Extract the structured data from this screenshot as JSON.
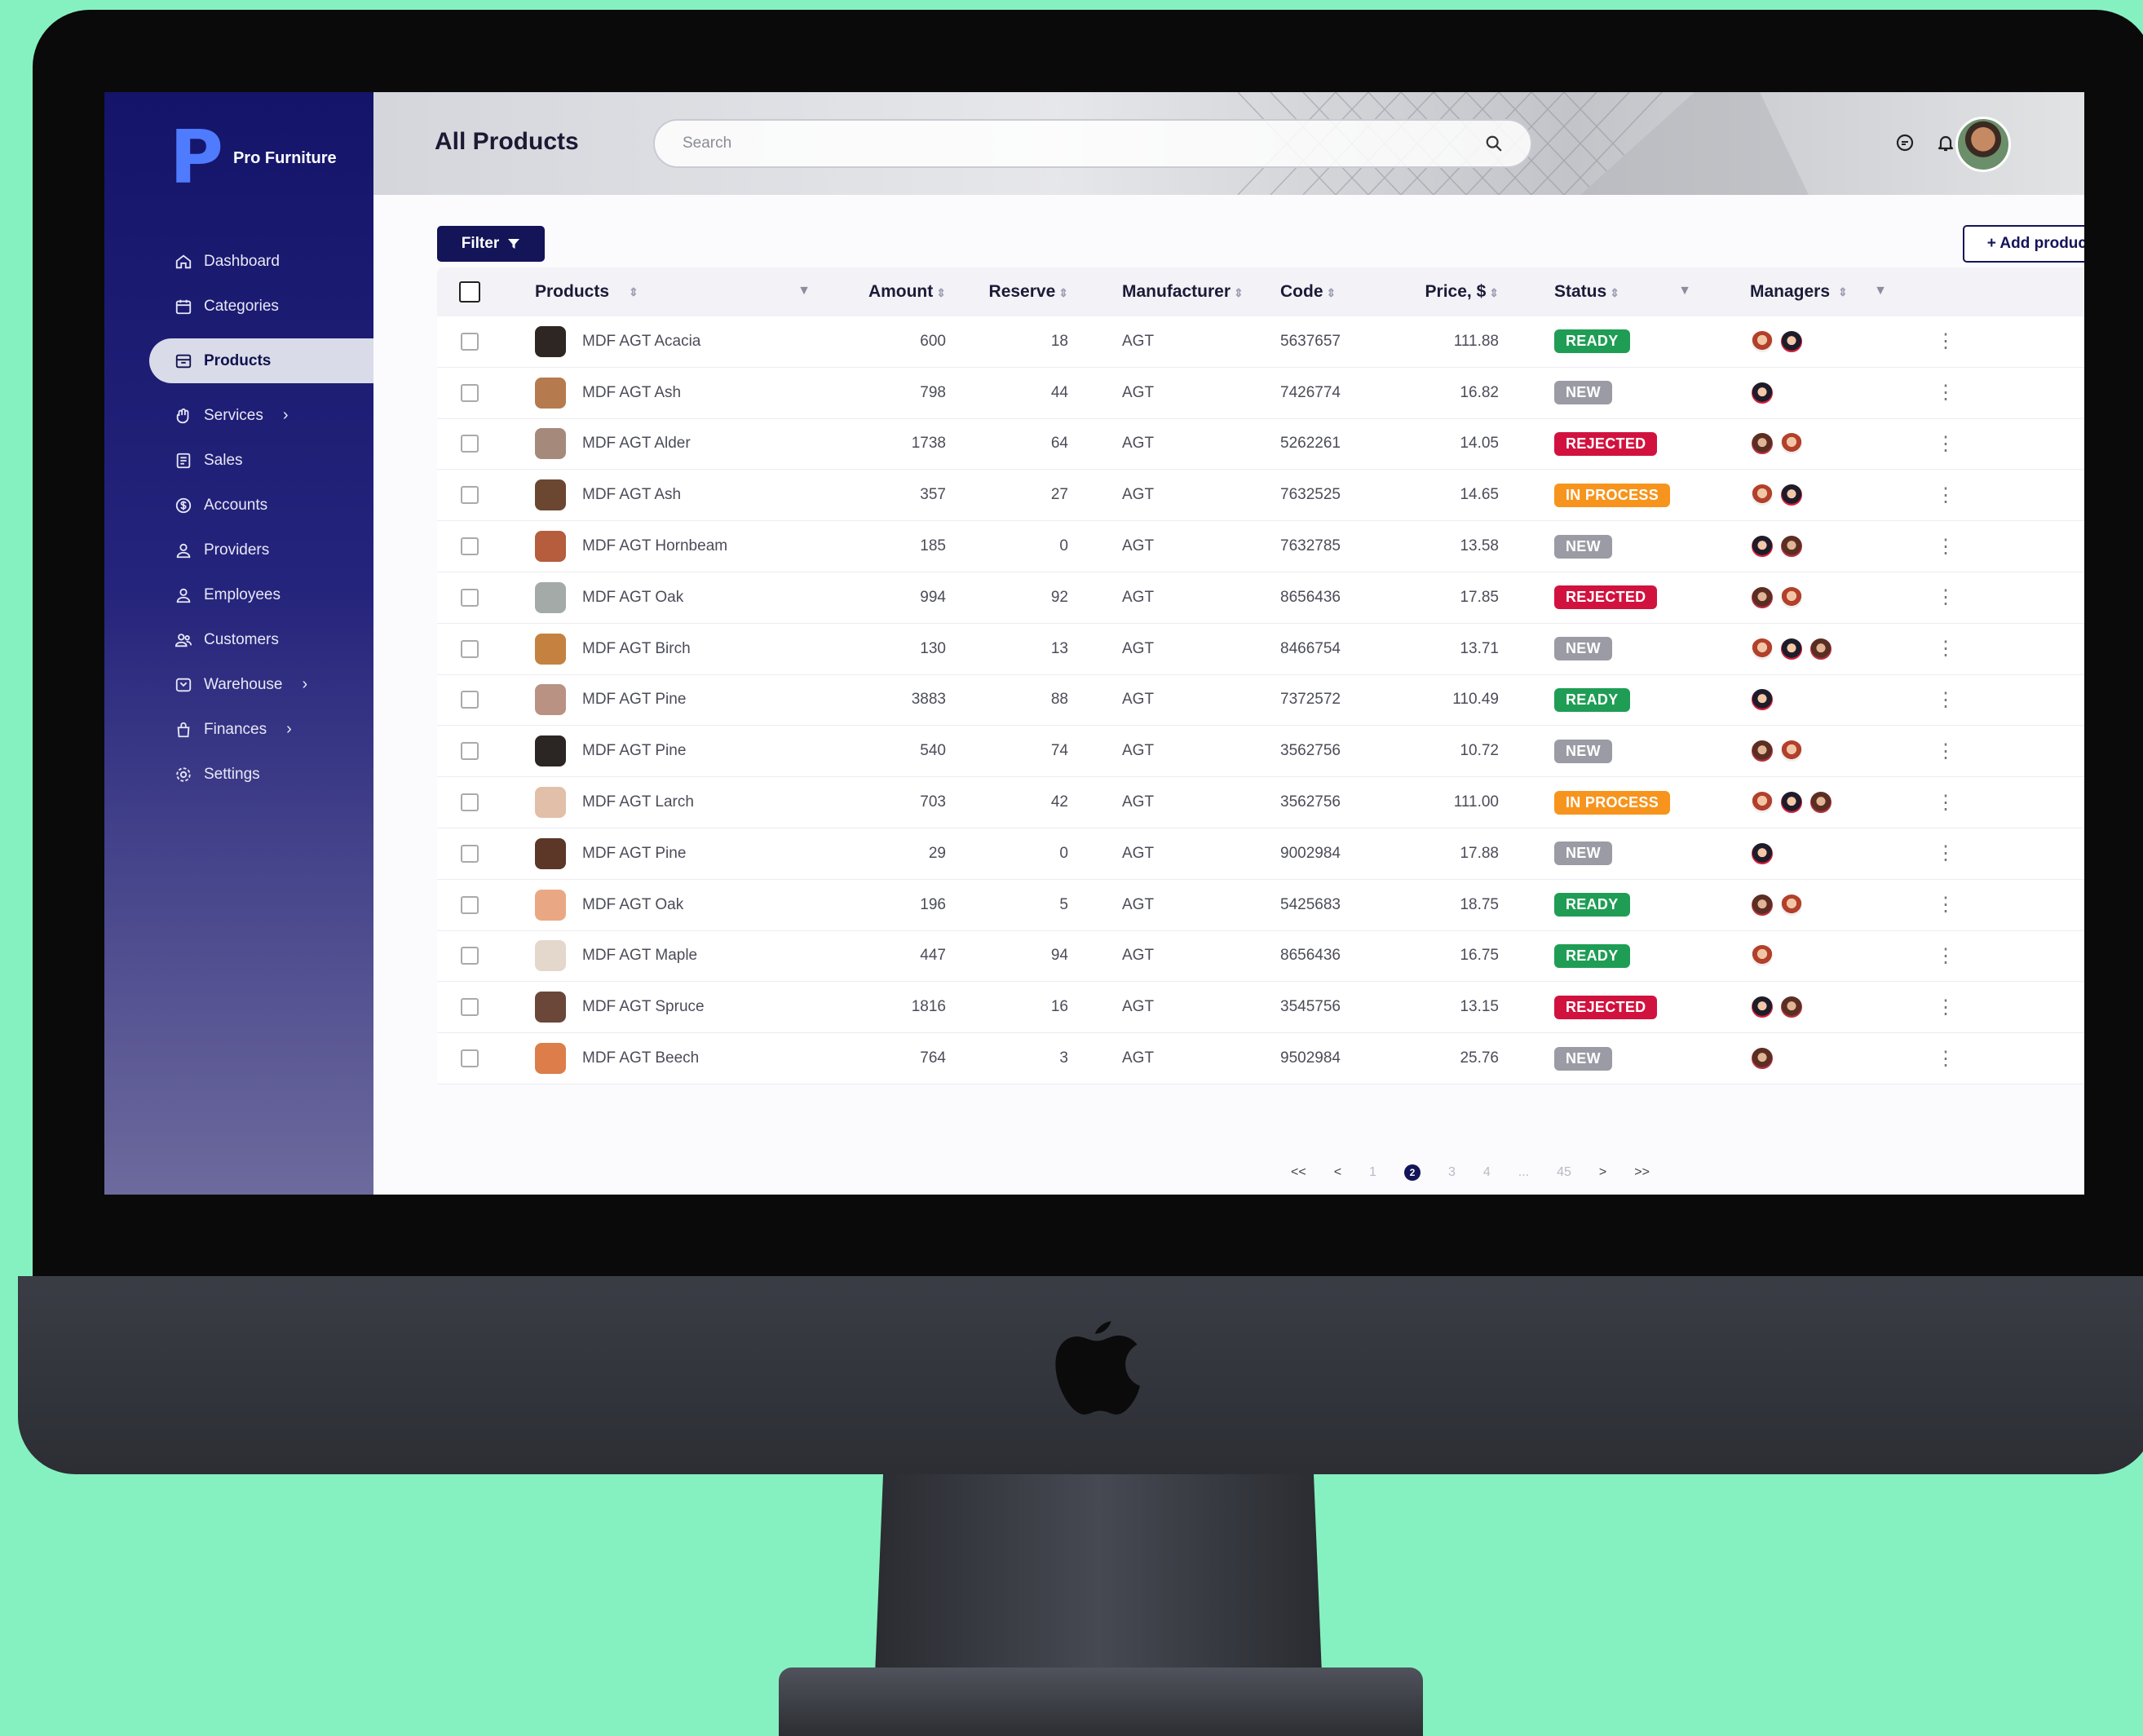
{
  "app": {
    "brand_letter": "P",
    "brand_name": "Pro Furniture",
    "page_title": "All Products"
  },
  "search": {
    "placeholder": "Search"
  },
  "sidebar": {
    "items": [
      {
        "label": "Dashboard",
        "icon": "home-icon",
        "chevron": false,
        "active": false
      },
      {
        "label": "Categories",
        "icon": "calendar-icon",
        "chevron": false,
        "active": false
      },
      {
        "label": "Products",
        "icon": "box-icon",
        "chevron": false,
        "active": true
      },
      {
        "label": "Services",
        "icon": "hand-icon",
        "chevron": true,
        "active": false
      },
      {
        "label": "Sales",
        "icon": "receipt-icon",
        "chevron": false,
        "active": false
      },
      {
        "label": "Accounts",
        "icon": "dollar-icon",
        "chevron": false,
        "active": false
      },
      {
        "label": "Providers",
        "icon": "user-icon",
        "chevron": false,
        "active": false
      },
      {
        "label": "Employees",
        "icon": "user-icon",
        "chevron": false,
        "active": false
      },
      {
        "label": "Customers",
        "icon": "users-icon",
        "chevron": false,
        "active": false
      },
      {
        "label": "Warehouse",
        "icon": "warehouse-icon",
        "chevron": true,
        "active": false
      },
      {
        "label": "Finances",
        "icon": "bag-icon",
        "chevron": true,
        "active": false
      },
      {
        "label": "Settings",
        "icon": "gear-icon",
        "chevron": false,
        "active": false
      }
    ]
  },
  "toolbar": {
    "filter_label": "Filter",
    "add_label": "+ Add product"
  },
  "table": {
    "headers": {
      "products": "Products",
      "amount": "Amount",
      "reserve": "Reserve",
      "manufacturer": "Manufacturer",
      "code": "Code",
      "price": "Price, $",
      "status": "Status",
      "managers": "Managers"
    },
    "status_colors": {
      "READY": "#1f9d55",
      "NEW": "#9a9ba4",
      "REJECTED": "#d1123f",
      "IN PROCESS": "#f7941d"
    },
    "rows": [
      {
        "product": "MDF AGT Acacia",
        "amount": "600",
        "reserve": "18",
        "manufacturer": "AGT",
        "code": "5637657",
        "price": "111.88",
        "status": "READY",
        "swatch": "#2e2622",
        "managers": 2
      },
      {
        "product": "MDF AGT Ash",
        "amount": "798",
        "reserve": "44",
        "manufacturer": "AGT",
        "code": "7426774",
        "price": "16.82",
        "status": "NEW",
        "swatch": "#b57a4e",
        "managers": 1
      },
      {
        "product": "MDF AGT Alder",
        "amount": "1738",
        "reserve": "64",
        "manufacturer": "AGT",
        "code": "5262261",
        "price": "14.05",
        "status": "REJECTED",
        "swatch": "#a58a7c",
        "managers": 2
      },
      {
        "product": "MDF AGT Ash",
        "amount": "357",
        "reserve": "27",
        "manufacturer": "AGT",
        "code": "7632525",
        "price": "14.65",
        "status": "IN PROCESS",
        "swatch": "#6b4630",
        "managers": 2
      },
      {
        "product": "MDF AGT Hornbeam",
        "amount": "185",
        "reserve": "0",
        "manufacturer": "AGT",
        "code": "7632785",
        "price": "13.58",
        "status": "NEW",
        "swatch": "#b55d3c",
        "managers": 2
      },
      {
        "product": "MDF AGT Oak",
        "amount": "994",
        "reserve": "92",
        "manufacturer": "AGT",
        "code": "8656436",
        "price": "17.85",
        "status": "REJECTED",
        "swatch": "#a3aaa8",
        "managers": 2
      },
      {
        "product": "MDF AGT Birch",
        "amount": "130",
        "reserve": "13",
        "manufacturer": "AGT",
        "code": "8466754",
        "price": "13.71",
        "status": "NEW",
        "swatch": "#c5813f",
        "managers": 3
      },
      {
        "product": "MDF AGT Pine",
        "amount": "3883",
        "reserve": "88",
        "manufacturer": "AGT",
        "code": "7372572",
        "price": "110.49",
        "status": "READY",
        "swatch": "#b99283",
        "managers": 1
      },
      {
        "product": "MDF AGT Pine",
        "amount": "540",
        "reserve": "74",
        "manufacturer": "AGT",
        "code": "3562756",
        "price": "10.72",
        "status": "NEW",
        "swatch": "#2b2624",
        "managers": 2
      },
      {
        "product": "MDF AGT Larch",
        "amount": "703",
        "reserve": "42",
        "manufacturer": "AGT",
        "code": "3562756",
        "price": "111.00",
        "status": "IN PROCESS",
        "swatch": "#e2bfa8",
        "managers": 3
      },
      {
        "product": "MDF AGT Pine",
        "amount": "29",
        "reserve": "0",
        "manufacturer": "AGT",
        "code": "9002984",
        "price": "17.88",
        "status": "NEW",
        "swatch": "#5c3626",
        "managers": 1
      },
      {
        "product": "MDF AGT Oak",
        "amount": "196",
        "reserve": "5",
        "manufacturer": "AGT",
        "code": "5425683",
        "price": "18.75",
        "status": "READY",
        "swatch": "#e9a883",
        "managers": 2
      },
      {
        "product": "MDF AGT Maple",
        "amount": "447",
        "reserve": "94",
        "manufacturer": "AGT",
        "code": "8656436",
        "price": "16.75",
        "status": "READY",
        "swatch": "#e4d7cb",
        "managers": 1
      },
      {
        "product": "MDF AGT Spruce",
        "amount": "1816",
        "reserve": "16",
        "manufacturer": "AGT",
        "code": "3545756",
        "price": "13.15",
        "status": "REJECTED",
        "swatch": "#6a4738",
        "managers": 2
      },
      {
        "product": "MDF AGT Beech",
        "amount": "764",
        "reserve": "3",
        "manufacturer": "AGT",
        "code": "9502984",
        "price": "25.76",
        "status": "NEW",
        "swatch": "#dc7d4a",
        "managers": 1
      }
    ]
  },
  "pagination": {
    "first": "<<",
    "prev": "<",
    "pages": [
      "1",
      "2",
      "3",
      "4",
      "...",
      "45"
    ],
    "current": "2",
    "next": ">",
    "last": ">>"
  }
}
